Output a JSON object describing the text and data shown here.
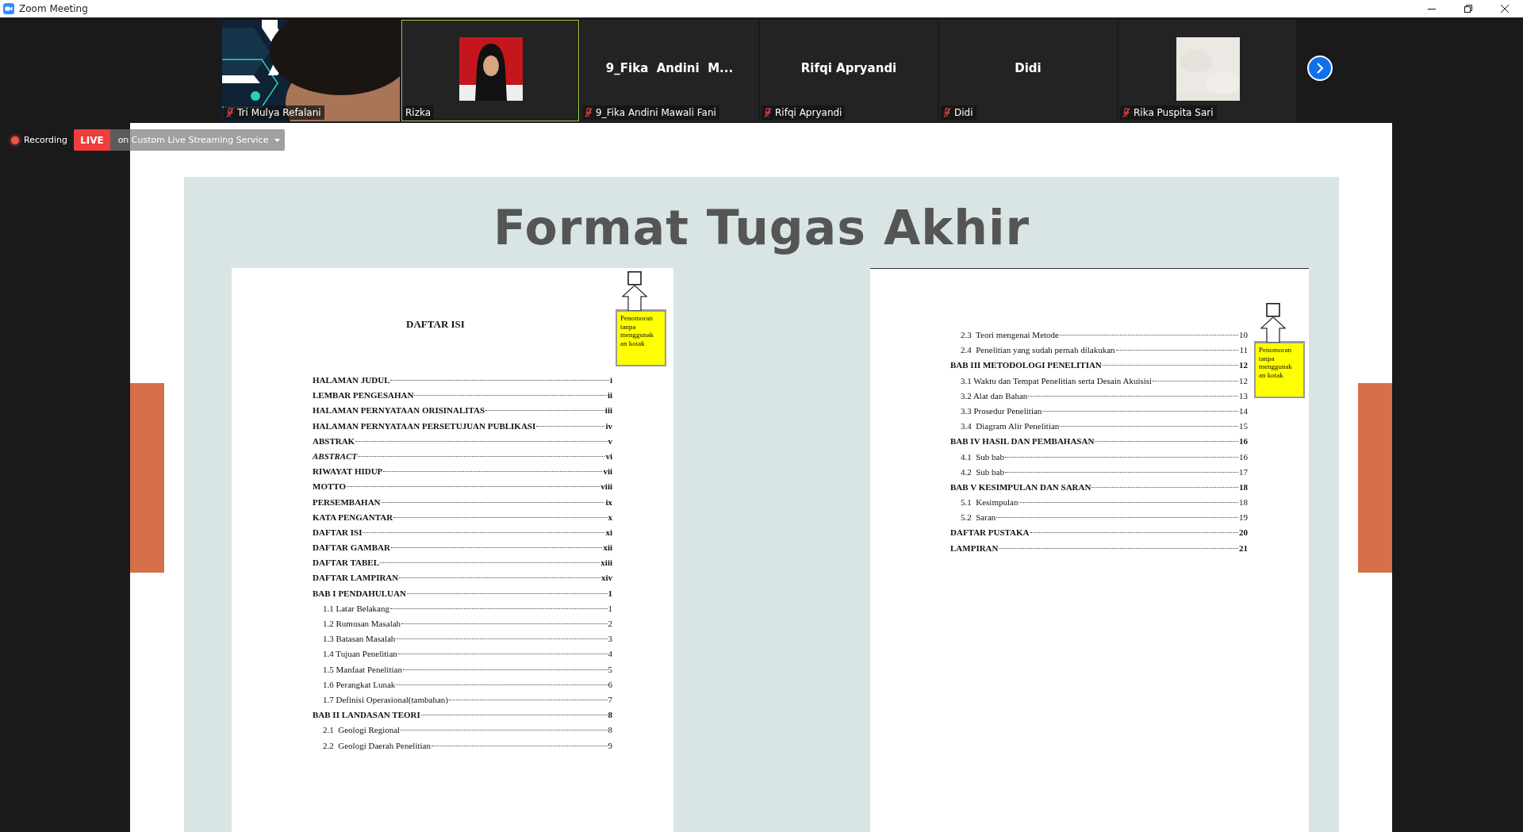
{
  "window": {
    "title": "Zoom Meeting"
  },
  "participants": [
    {
      "kind": "video",
      "name": "Tri Mulya Refalani",
      "muted": true,
      "active_speaker": false
    },
    {
      "name": "Rizka",
      "muted": false,
      "active_speaker": true
    },
    {
      "kind": "name",
      "display_name": "9_Fika  Andini  M...",
      "name": "9_Fika Andini Mawali Fani",
      "muted": true,
      "active_speaker": false
    },
    {
      "kind": "name",
      "display_name": "Rifqi Apryandi",
      "name": "Rifqi Apryandi",
      "muted": true,
      "active_speaker": false
    },
    {
      "kind": "name",
      "display_name": "Didi",
      "name": "Didi",
      "muted": true,
      "active_speaker": false
    },
    {
      "name": "Rika Puspita Sari",
      "muted": true,
      "active_speaker": false
    }
  ],
  "recording": {
    "label": "Recording",
    "badge": "LIVE",
    "service": "on Custom Live Streaming Service"
  },
  "slide": {
    "title": "Format Tugas Akhir",
    "pages": [
      {
        "heading": "DAFTAR ISI",
        "callout": [
          "Penomoran",
          "tanpa",
          "menggunak",
          "an kotak"
        ],
        "entries": [
          {
            "kind": "chapter",
            "title": "HALAMAN JUDUL",
            "page": "i"
          },
          {
            "kind": "chapter",
            "title": "LEMBAR PENGESAHAN",
            "page": "ii"
          },
          {
            "kind": "chapter",
            "title": "HALAMAN PERNYATAAN ORISINALITAS",
            "page": "iii"
          },
          {
            "kind": "chapter",
            "title": "HALAMAN PERNYATAAN PERSETUJUAN PUBLIKASI",
            "page": "iv"
          },
          {
            "kind": "chapter",
            "title": "ABSTRAK",
            "page": "v"
          },
          {
            "kind": "chapter",
            "title": "ABSTRACT",
            "page": "vi",
            "italic": true
          },
          {
            "kind": "chapter",
            "title": "RIWAYAT HIDUP",
            "page": "vii"
          },
          {
            "kind": "chapter",
            "title": "MOTTO",
            "page": "viii"
          },
          {
            "kind": "chapter",
            "title": "PERSEMBAHAN",
            "page": "ix"
          },
          {
            "kind": "chapter",
            "title": "KATA PENGANTAR",
            "page": "x"
          },
          {
            "kind": "chapter",
            "title": "DAFTAR ISI",
            "page": "xi"
          },
          {
            "kind": "chapter",
            "title": "DAFTAR GAMBAR",
            "page": "xii"
          },
          {
            "kind": "chapter",
            "title": "DAFTAR TABEL",
            "page": "xiii"
          },
          {
            "kind": "chapter",
            "title": "DAFTAR LAMPIRAN",
            "page": "xiv"
          },
          {
            "kind": "chapter",
            "title": "BAB I PENDAHULUAN",
            "page": "1"
          },
          {
            "kind": "sub",
            "title": "1.1 Latar Belakang",
            "page": "1"
          },
          {
            "kind": "sub",
            "title": "1.2 Rumusan Masalah",
            "page": "2"
          },
          {
            "kind": "sub",
            "title": "1.3 Batasan Masalah",
            "page": "3"
          },
          {
            "kind": "sub",
            "title": "1.4 Tujuan Penelitian",
            "page": "4"
          },
          {
            "kind": "sub",
            "title": "1.5 Manfaat Penelitian",
            "page": "5"
          },
          {
            "kind": "sub",
            "title": "1.6 Perangkat Lunak",
            "page": "6"
          },
          {
            "kind": "sub",
            "title": "1.7 Definisi Operasional(tambahan)",
            "page": "7"
          },
          {
            "kind": "chapter",
            "title": "BAB II LANDASAN TEORI",
            "page": "8"
          },
          {
            "kind": "sub",
            "title": "2.1  Geologi Regional",
            "page": "8"
          },
          {
            "kind": "sub",
            "title": "2.2  Geologi Daerah Penelitian",
            "page": "9"
          }
        ]
      },
      {
        "callout": [
          "Penomoran",
          "tanpa",
          "menggunak",
          "an kotak"
        ],
        "entries": [
          {
            "kind": "sub",
            "title": "2.3  Teori mengenai Metode",
            "page": "10"
          },
          {
            "kind": "sub",
            "title": "2.4  Penelitian yang sudah pernah dilakukan",
            "page": "11"
          },
          {
            "kind": "chapter",
            "title": "BAB III METODOLOGI PENELITIAN",
            "page": "12"
          },
          {
            "kind": "sub",
            "title": "3.1 Waktu dan Tempat Penelitian serta Desain Akuisisi",
            "page": "12"
          },
          {
            "kind": "sub",
            "title": "3.2 Alat dan Bahan",
            "page": "13"
          },
          {
            "kind": "sub",
            "title": "3.3 Prosedur Penelitian",
            "page": "14"
          },
          {
            "kind": "sub",
            "title": "3.4  Diagram Alir Penelitian",
            "page": "15"
          },
          {
            "kind": "chapter",
            "title": "BAB IV HASIL DAN PEMBAHASAN",
            "page": "16"
          },
          {
            "kind": "sub",
            "title": "4.1  Sub bab",
            "page": "16"
          },
          {
            "kind": "sub",
            "title": "4.2  Sub bab",
            "page": "17"
          },
          {
            "kind": "chapter",
            "title": "BAB V KESIMPULAN DAN SARAN",
            "page": "18"
          },
          {
            "kind": "sub",
            "title": "5.1  Kesimpulan",
            "page": "18"
          },
          {
            "kind": "sub",
            "title": "5.2  Saran",
            "page": "19"
          },
          {
            "kind": "chapter",
            "title": "DAFTAR PUSTAKA",
            "page": "20"
          },
          {
            "kind": "chapter",
            "title": "LAMPIRAN",
            "page": "21"
          }
        ]
      }
    ]
  }
}
